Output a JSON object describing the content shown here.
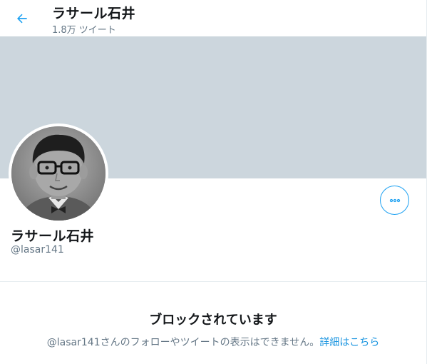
{
  "header": {
    "title": "ラサール石井",
    "tweet_count": "1.8万 ツイート"
  },
  "profile": {
    "display_name": "ラサール石井",
    "handle": "@lasar141"
  },
  "blocked": {
    "title": "ブロックされています",
    "message": "@lasar141さんのフォローやツイートの表示はできません。",
    "link": "詳細はこちら"
  },
  "colors": {
    "accent": "#1da1f2",
    "banner": "#ccd6dd",
    "secondary_text": "#657786"
  },
  "icons": {
    "back": "arrow-left-icon",
    "more": "more-horizontal-icon"
  }
}
